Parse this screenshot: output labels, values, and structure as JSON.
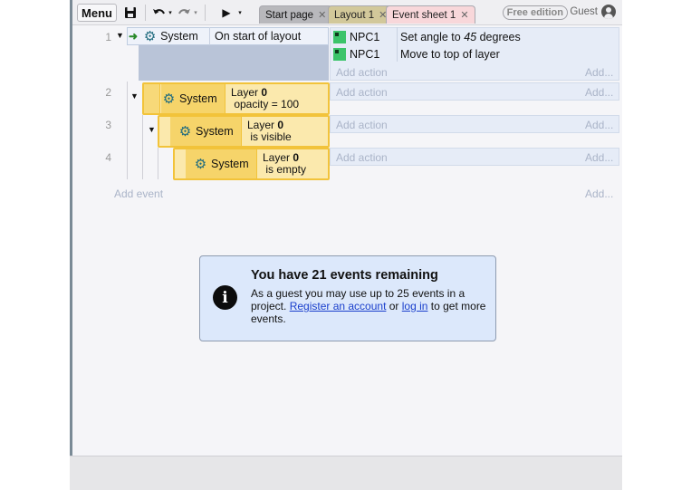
{
  "toolbar": {
    "menu_label": "Menu",
    "tabs": [
      {
        "label": "Start page"
      },
      {
        "label": "Layout 1"
      },
      {
        "label": "Event sheet 1"
      }
    ],
    "free_edition": "Free edition",
    "guest": "Guest"
  },
  "events": [
    {
      "number": "1",
      "condition": {
        "object": "System",
        "text": "On start of layout"
      },
      "actions": [
        {
          "object": "NPC1",
          "text": "Set angle to ",
          "value": "45",
          "suffix": " degrees"
        },
        {
          "object": "NPC1",
          "text": "Move to top of layer"
        }
      ],
      "add_action": "Add action",
      "add": "Add..."
    },
    {
      "number": "2",
      "condition": {
        "object": "System",
        "text_pre": "Layer ",
        "bold": "0",
        "text_post": " opacity = 100"
      },
      "add_action": "Add action",
      "add": "Add..."
    },
    {
      "number": "3",
      "condition": {
        "object": "System",
        "text_pre": "Layer ",
        "bold": "0",
        "text_post": " is visible"
      },
      "add_action": "Add action",
      "add": "Add..."
    },
    {
      "number": "4",
      "condition": {
        "object": "System",
        "text_pre": "Layer ",
        "bold": "0",
        "text_post": " is empty"
      },
      "add_action": "Add action",
      "add": "Add..."
    }
  ],
  "add_event": "Add event",
  "add_event_more": "Add...",
  "notice": {
    "title": "You have 21 events remaining",
    "body_pre": "As a guest you may use up to 25 events in a project. ",
    "register_link": "Register an account",
    "or": " or ",
    "login_link": "log in",
    "body_post": " to get more events."
  },
  "colors": {
    "condition_block": "#dde7f7",
    "selected_yellow": "#fbe9ad",
    "notice_bg": "#dce8fb",
    "npc_green": "#3cc46a"
  },
  "icons": {
    "save": "save-icon",
    "undo": "undo-icon",
    "redo": "redo-icon",
    "play": "play-icon",
    "system": "gear-icon",
    "info": "info-icon",
    "user": "user-icon"
  }
}
